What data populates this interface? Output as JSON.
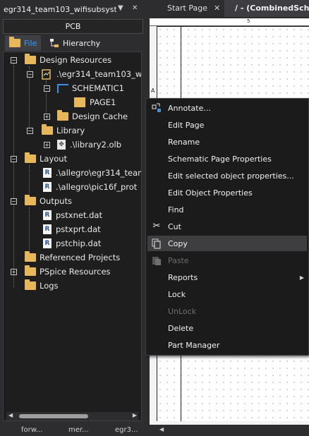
{
  "panel": {
    "title": "egr314_team103_wifisubsyst...",
    "pin": "▼",
    "close": "✕",
    "section": "PCB",
    "tabs": {
      "file": "File",
      "hierarchy": "Hierarchy"
    }
  },
  "tree": {
    "design_resources": "Design Resources",
    "dsn": ".\\egr314_team103_w",
    "schematic": "SCHEMATIC1",
    "page": "PAGE1",
    "design_cache": "Design Cache",
    "library": "Library",
    "library_file": ".\\library2.olb",
    "layout": "Layout",
    "layout_1": ".\\allegro\\egr314_team",
    "layout_2": ".\\allegro\\pic16f_prot",
    "outputs": "Outputs",
    "out_1": "pstxnet.dat",
    "out_2": "pstxprt.dat",
    "out_3": "pstchip.dat",
    "referenced": "Referenced Projects",
    "pspice": "PSpice Resources",
    "logs": "Logs"
  },
  "bottom_tabs": [
    "forw...",
    "mer...",
    "egr3..."
  ],
  "doc_tabs": {
    "start": "Start Page",
    "active": "/ - (CombinedSchem"
  },
  "ruler_mark": "5",
  "side_mark": "A",
  "menu": {
    "annotate": "Annotate...",
    "edit_page": "Edit Page",
    "rename": "Rename",
    "sch_props": "Schematic Page Properties",
    "edit_selected": "Edit selected object properties...",
    "edit_obj": "Edit Object Properties",
    "find": "Find",
    "cut": "Cut",
    "copy": "Copy",
    "paste": "Paste",
    "reports": "Reports",
    "lock": "Lock",
    "unlock": "UnLock",
    "delete": "Delete",
    "part_manager": "Part Manager"
  },
  "colors": {
    "accent": "#3399ff",
    "menu_bg": "#1b1b1c",
    "highlight": "#3e3e40",
    "folder": "#e8b75a"
  },
  "icons": {
    "annotate": "annotate-icon",
    "cut": "scissors-icon",
    "copy": "copy-icon",
    "paste": "paste-icon",
    "reports": "submenu-arrow-icon"
  }
}
